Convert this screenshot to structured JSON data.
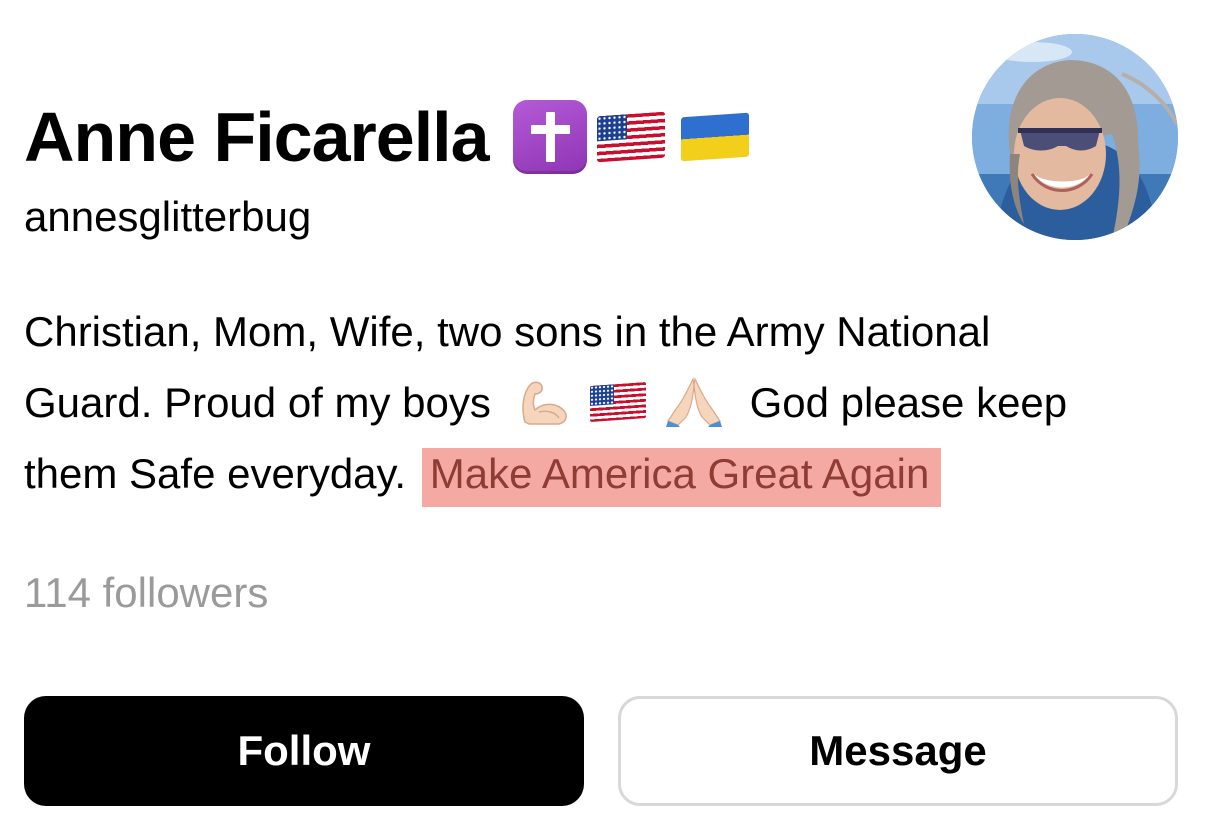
{
  "profile": {
    "display_name": "Anne Ficarella",
    "name_badges": [
      "latin-cross-emoji",
      "us-flag-emoji",
      "ukraine-flag-emoji"
    ],
    "username": "annesglitterbug",
    "bio": {
      "line1": "Christian, Mom, Wife, two sons in the Army National",
      "line2_before": "Guard. Proud of my boys",
      "line2_emojis": [
        "flexed-biceps-emoji",
        "us-flag-emoji",
        "folded-hands-emoji"
      ],
      "line2_after": "God please keep",
      "line3_before": "them Safe everyday.",
      "line3_highlight": "Make America Great Again"
    },
    "followers": "114 followers"
  },
  "actions": {
    "follow_label": "Follow",
    "message_label": "Message"
  },
  "colors": {
    "highlight_bg": "#f4aaa3",
    "highlight_text": "#8f3d34",
    "follow_bg": "#000000",
    "muted_text": "#9a9a9a",
    "badge_purple": "#9b44c4"
  }
}
